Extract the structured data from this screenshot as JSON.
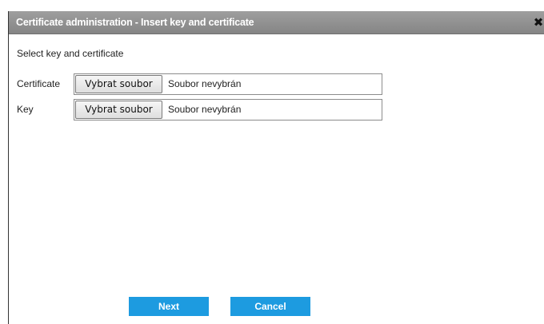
{
  "dialog": {
    "title": "Certificate administration - Insert key and certificate",
    "close_icon": "close-icon",
    "intro": "Select key and certificate"
  },
  "fields": [
    {
      "label": "Certificate",
      "button": "Vybrat soubor",
      "status": "Soubor nevybrán"
    },
    {
      "label": "Key",
      "button": "Vybrat soubor",
      "status": "Soubor nevybrán"
    }
  ],
  "actions": {
    "next": "Next",
    "cancel": "Cancel"
  },
  "colors": {
    "titlebar": "#8f8f8f",
    "primary_button": "#1d9be0",
    "title_text": "#ffffff"
  }
}
